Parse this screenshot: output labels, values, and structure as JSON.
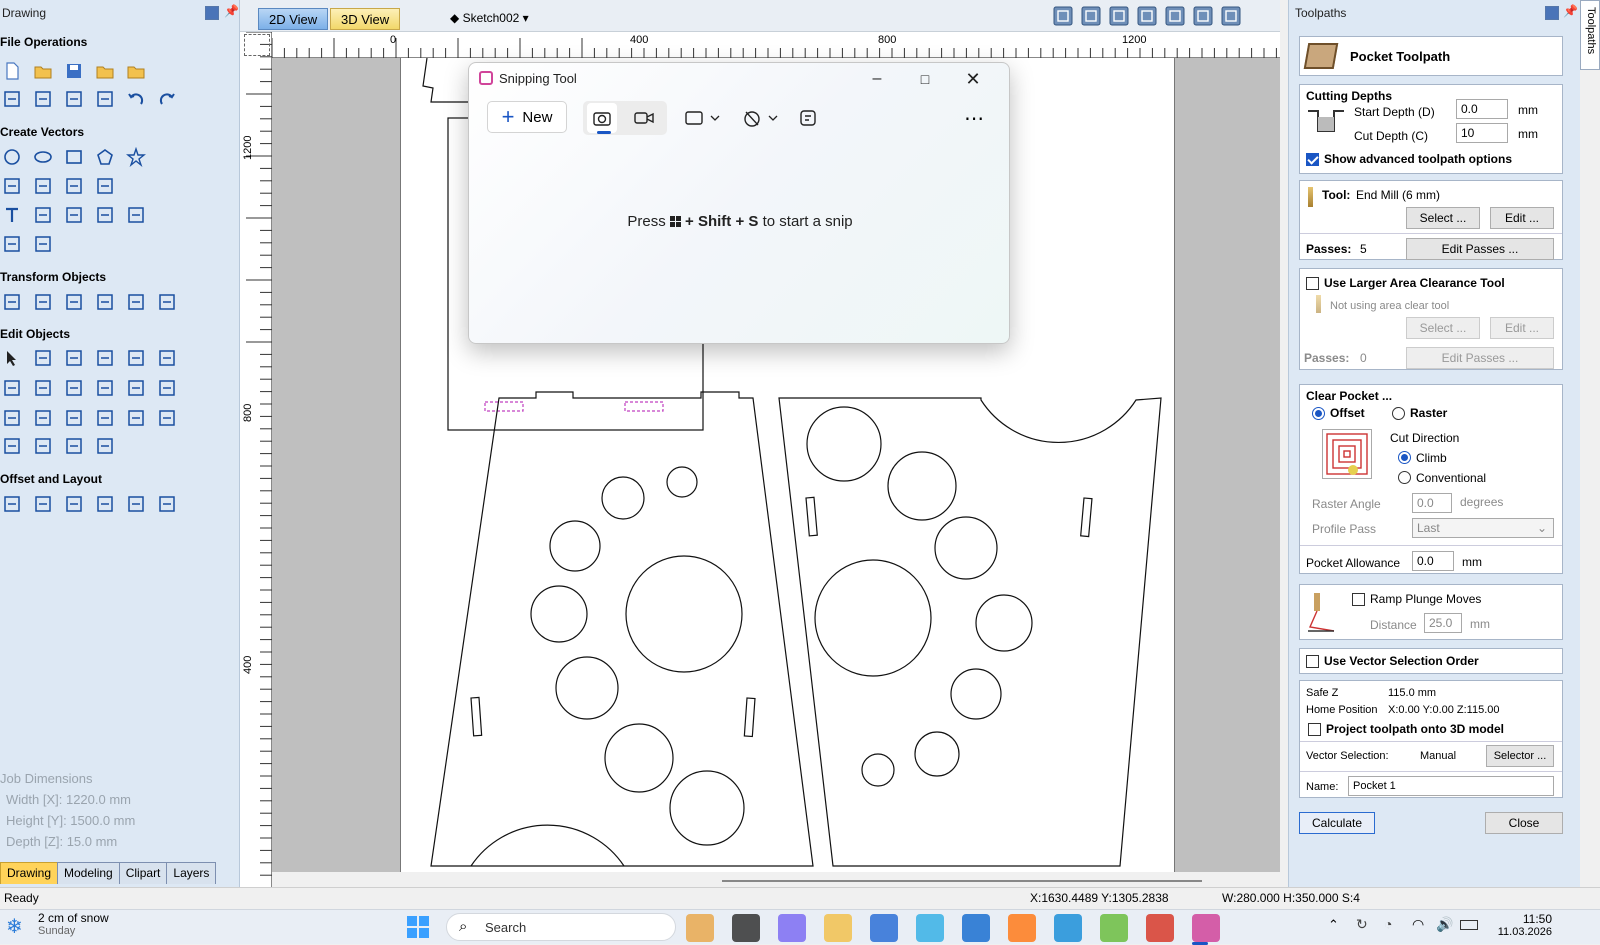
{
  "left_panel": {
    "title": "Drawing",
    "sections": {
      "file_ops": "File Operations",
      "create_vectors": "Create Vectors",
      "transform": "Transform Objects",
      "edit": "Edit Objects",
      "offset_layout": "Offset and Layout"
    },
    "job_dimensions": {
      "title": "Job Dimensions",
      "width": "Width  [X]: 1220.0 mm",
      "height": "Height [Y]: 1500.0 mm",
      "depth": "Depth  [Z]: 15.0 mm"
    },
    "tabs": [
      "Drawing",
      "Modeling",
      "Clipart",
      "Layers"
    ]
  },
  "view": {
    "tab_2d": "2D View",
    "tab_3d": "3D View",
    "sketch": "Sketch002",
    "ruler_top": [
      "0",
      "400",
      "800",
      "1200"
    ],
    "ruler_left": [
      "1200",
      "800",
      "400"
    ]
  },
  "snipping_tool": {
    "title": "Snipping Tool",
    "new_label": "New",
    "hint_before": "Press",
    "hint_mid": "+ Shift +",
    "hint_key": "S",
    "hint_after": "to start a snip"
  },
  "toolpaths": {
    "panel_title": "Toolpaths",
    "side_tab": "Toolpaths",
    "header": "Pocket Toolpath",
    "cutting_depths": {
      "title": "Cutting Depths",
      "start_label": "Start Depth (D)",
      "start_value": "0.0",
      "cut_label": "Cut Depth (C)",
      "cut_value": "10",
      "unit": "mm",
      "advanced": "Show advanced toolpath options",
      "advanced_checked": true
    },
    "tool": {
      "label": "Tool:",
      "value": "End Mill (6 mm)",
      "select": "Select ...",
      "edit": "Edit ...",
      "passes_label": "Passes:",
      "passes_value": "5",
      "edit_passes": "Edit Passes ..."
    },
    "area_clear": {
      "label": "Use Larger Area Clearance Tool",
      "checked": false,
      "info": "Not using area clear tool",
      "select": "Select ...",
      "edit": "Edit ...",
      "passes_label": "Passes:",
      "passes_value": "0",
      "edit_passes": "Edit Passes ..."
    },
    "clear_pocket": {
      "title": "Clear Pocket ...",
      "offset": "Offset",
      "raster": "Raster",
      "mode_selected": "Offset",
      "cut_direction": "Cut Direction",
      "climb": "Climb",
      "conventional": "Conventional",
      "direction_selected": "Climb",
      "raster_angle_label": "Raster Angle",
      "raster_angle_value": "0.0",
      "raster_angle_unit": "degrees",
      "profile_pass_label": "Profile Pass",
      "profile_pass_value": "Last"
    },
    "pocket_allowance": {
      "label": "Pocket Allowance",
      "value": "0.0",
      "unit": "mm"
    },
    "ramp": {
      "label": "Ramp Plunge Moves",
      "checked": false,
      "distance_label": "Distance",
      "distance_value": "25.0",
      "unit": "mm"
    },
    "vector_order": {
      "label": "Use Vector Selection Order",
      "checked": false
    },
    "safe_z": {
      "label": "Safe Z",
      "value": "115.0 mm"
    },
    "home": {
      "label": "Home Position",
      "value": "X:0.00 Y:0.00 Z:115.00"
    },
    "project": {
      "label": "Project toolpath onto 3D model",
      "checked": false
    },
    "vector_selection": {
      "label": "Vector Selection:",
      "value": "Manual",
      "button": "Selector ..."
    },
    "name": {
      "label": "Name:",
      "value": "Pocket 1"
    },
    "calculate": "Calculate",
    "close": "Close"
  },
  "status_bar": {
    "left": "Ready",
    "coords": "X:1630.4489 Y:1305.2838",
    "size": "W:280.000  H:350.000  S:4"
  },
  "taskbar": {
    "weather_line1": "2 cm of snow",
    "weather_line2": "Sunday",
    "search": "Search",
    "time": "11:50",
    "date": "11.03.2026"
  },
  "colors": {
    "panel_bg": "#dde8f4",
    "accent": "#1a56c4",
    "tab_2d": "#7cb0e8",
    "tab_3d": "#f2d86a",
    "active_left_tab": "#ffd35a"
  }
}
